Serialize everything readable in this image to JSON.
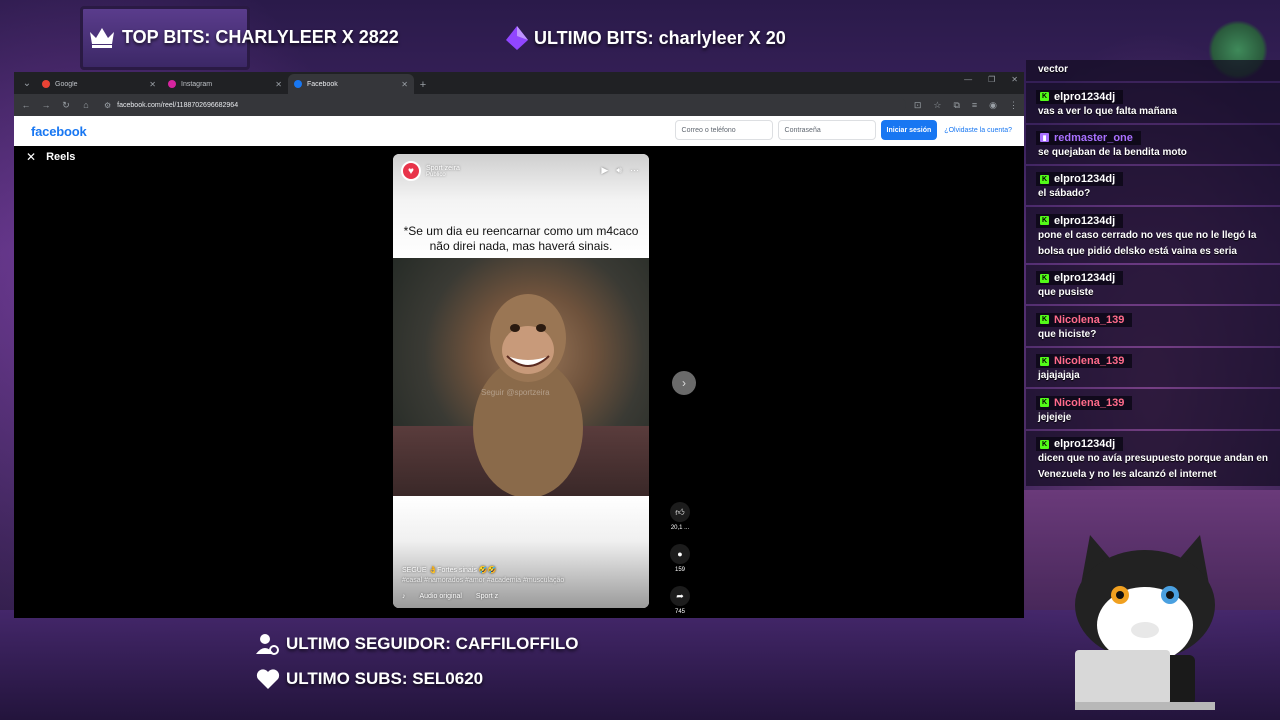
{
  "overlay": {
    "top_bits": "TOP BITS: CHARLYLEER X 2822",
    "last_bits": "ULTIMO BITS: charlyleer X 20",
    "last_follower": "ULTIMO SEGUIDOR: CAFFILOFFILO",
    "last_subs": "ULTIMO SUBS: SEL0620"
  },
  "browser": {
    "tabs": [
      {
        "label": "Google",
        "favicon_color": "#ea4335",
        "active": false
      },
      {
        "label": "Instagram",
        "favicon_color": "#d6249f",
        "active": false
      },
      {
        "label": "Facebook",
        "favicon_color": "#1877f2",
        "active": true
      }
    ],
    "url": "facebook.com/reel/1188702696682964"
  },
  "facebook": {
    "logo": "facebook",
    "email_placeholder": "Correo o teléfono",
    "password_placeholder": "Contraseña",
    "login_button": "Iniciar sesión",
    "forgot_link": "¿Olvidaste la cuenta?",
    "reels_title": "Reels"
  },
  "reel": {
    "author": "Sport zeira",
    "privacy": "Público",
    "caption_line1": "*Se um dia eu reencarnar como um m4caco",
    "caption_line2": "não direi nada, mas haverá sinais.",
    "watermark": "Seguir @sportzeira",
    "description": "SEGUE 👌Fortes sinais 🤣🤣",
    "tags": "#casal #namorados #amor #academia #musculação",
    "audio_label": "Audio original",
    "audio_author": "Sport z",
    "likes": "20,1 ...",
    "comments": "159",
    "shares": "745"
  },
  "chat": [
    {
      "user": "",
      "text": "vector",
      "badge": "none"
    },
    {
      "user": "elpro1234dj",
      "text": "vas a ver lo que falta mañana",
      "badge": "kick",
      "color": "#ffffff"
    },
    {
      "user": "redmaster_one",
      "text": "se quejaban de la bendita moto",
      "badge": "purple",
      "color": "#a970ff"
    },
    {
      "user": "elpro1234dj",
      "text": "el sábado?",
      "badge": "kick",
      "color": "#ffffff"
    },
    {
      "user": "elpro1234dj",
      "text": "pone el caso cerrado no ves que no le llegó la bolsa que pidió delsko está vaina es seria",
      "badge": "kick",
      "color": "#ffffff"
    },
    {
      "user": "elpro1234dj",
      "text": "que pusiste",
      "badge": "kick",
      "color": "#ffffff"
    },
    {
      "user": "Nicolena_139",
      "text": "que hiciste?",
      "badge": "kick",
      "color": "#ff6b8a"
    },
    {
      "user": "Nicolena_139",
      "text": "jajajajaja",
      "badge": "kick",
      "color": "#ff6b8a"
    },
    {
      "user": "Nicolena_139",
      "text": "jejejeje",
      "badge": "kick",
      "color": "#ff6b8a"
    },
    {
      "user": "elpro1234dj",
      "text": "dicen que no avía presupuesto porque andan en Venezuela y no les alcanzó el internet",
      "badge": "kick",
      "color": "#ffffff"
    }
  ],
  "icons": {
    "crown": "crown-icon",
    "bits": "bits-gem-icon",
    "follower": "user-icon",
    "heart": "heart-icon"
  },
  "colors": {
    "facebook_blue": "#1877f2",
    "kick_green": "#53fc18",
    "twitch_purple": "#a970ff"
  }
}
